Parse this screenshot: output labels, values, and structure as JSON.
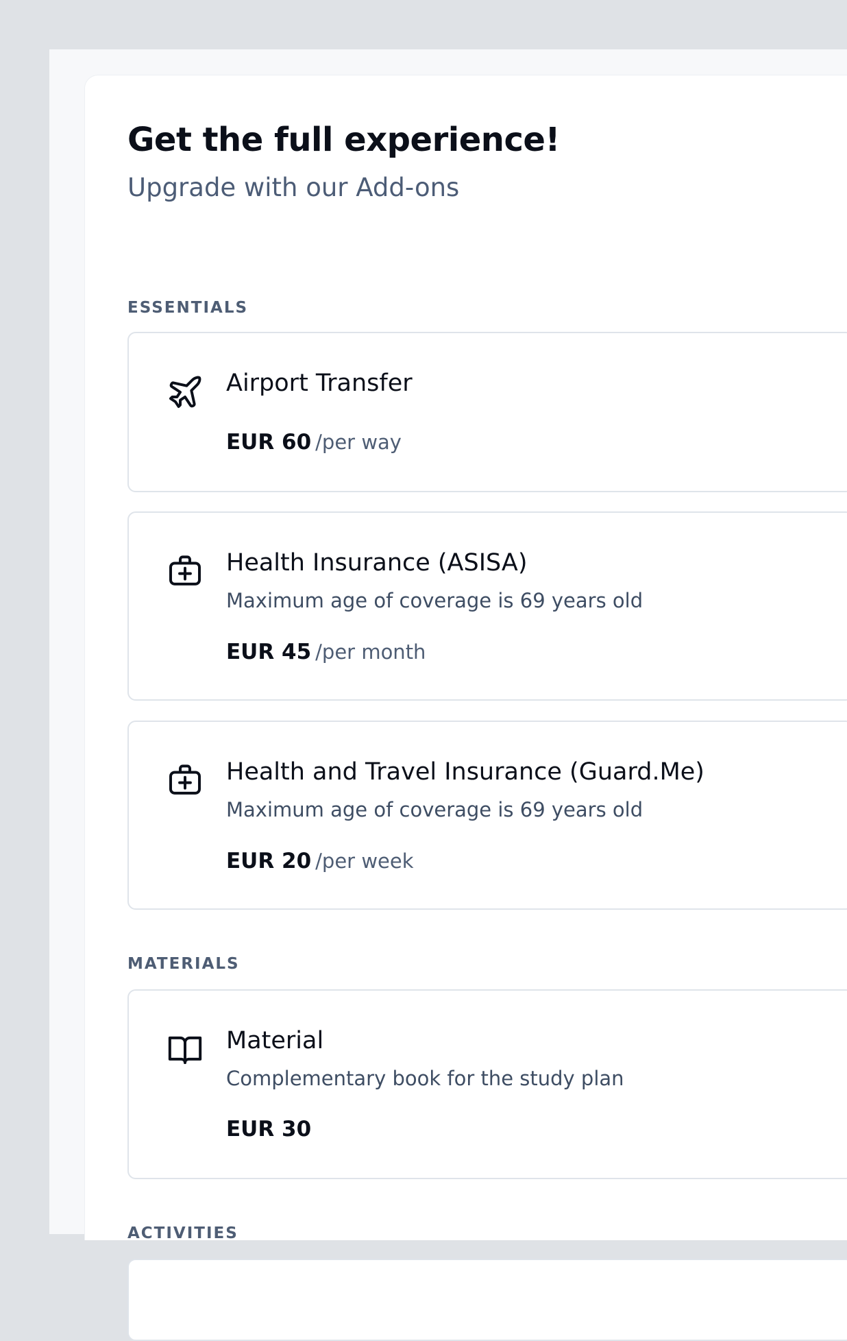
{
  "header": {
    "title": "Get the full experience!",
    "subtitle": "Upgrade with our Add-ons"
  },
  "sections": [
    {
      "heading": "ESSENTIALS",
      "items": [
        {
          "icon": "airplane-icon",
          "name": "Airport Transfer",
          "description": "",
          "price": "EUR 60",
          "unit": "/per way"
        },
        {
          "icon": "medical-kit-icon",
          "name": "Health Insurance (ASISA)",
          "description": "Maximum age of coverage is 69 years old",
          "price": "EUR 45",
          "unit": "/per month"
        },
        {
          "icon": "medical-kit-icon",
          "name": "Health and Travel Insurance (Guard.Me)",
          "description": "Maximum age of coverage is 69 years old",
          "price": "EUR 20",
          "unit": "/per week"
        }
      ]
    },
    {
      "heading": "MATERIALS",
      "items": [
        {
          "icon": "book-icon",
          "name": "Material",
          "description": "Complementary book for the study plan",
          "price": "EUR 30",
          "unit": ""
        }
      ]
    },
    {
      "heading": "ACTIVITIES",
      "items": []
    }
  ]
}
